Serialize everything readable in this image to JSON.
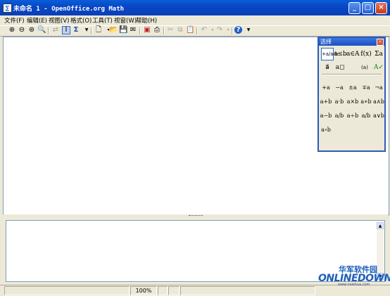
{
  "window": {
    "title": "未命名 1 - OpenOffice.org Math",
    "app_icon": "math-doc-icon",
    "buttons": [
      "_",
      "□",
      "×"
    ]
  },
  "menu": [
    "文件(F)",
    "编辑(E)",
    "视图(V)",
    "格式(O)",
    "工具(T)",
    "视窗(W)",
    "帮助(H)"
  ],
  "toolbar": [
    {
      "icon": "zoom-in-icon",
      "glyph": "⊕"
    },
    {
      "icon": "zoom-out-icon",
      "glyph": "⊖"
    },
    {
      "icon": "zoom-100-icon",
      "glyph": "⊛"
    },
    {
      "icon": "show-all-icon",
      "glyph": "🔍"
    },
    {
      "icon": "update-icon",
      "glyph": "⇄"
    },
    {
      "icon": "formula-cursor-icon",
      "glyph": "I"
    },
    {
      "icon": "sigma-icon",
      "glyph": "Σ"
    },
    {
      "icon": "new-icon",
      "glyph": "🗋"
    },
    {
      "icon": "open-icon",
      "glyph": "📂"
    },
    {
      "icon": "save-icon",
      "glyph": "💾"
    },
    {
      "icon": "mail-icon",
      "glyph": "✉"
    },
    {
      "icon": "export-pdf-icon",
      "glyph": "▣"
    },
    {
      "icon": "print-icon",
      "glyph": "⎙"
    },
    {
      "icon": "cut-icon",
      "glyph": "✂"
    },
    {
      "icon": "copy-icon",
      "glyph": "⧉"
    },
    {
      "icon": "paste-icon",
      "glyph": "📋"
    },
    {
      "icon": "undo-icon",
      "glyph": "↶"
    },
    {
      "icon": "redo-icon",
      "glyph": "↷"
    },
    {
      "icon": "help-icon",
      "glyph": "?"
    }
  ],
  "selection_panel": {
    "title": "选择",
    "categories": [
      {
        "icon": "unary-binary-operators-icon",
        "label": "+a/a·b"
      },
      {
        "icon": "relations-icon",
        "label": "a≤b"
      },
      {
        "icon": "set-operations-icon",
        "label": "a∈A"
      },
      {
        "icon": "functions-icon",
        "label": "f(x)"
      },
      {
        "icon": "operators-icon",
        "label": "Σa"
      },
      {
        "icon": "attributes-icon",
        "label": "a⃗"
      },
      {
        "icon": "others-icon",
        "label": "a◻"
      },
      {
        "icon": "brackets-icon",
        "label": "(a)"
      },
      {
        "icon": "formats-icon",
        "label": "(a b)"
      },
      {
        "icon": "format-icon",
        "label": "A✓"
      }
    ],
    "symbols": [
      "+a",
      "−a",
      "±a",
      "∓a",
      "¬a",
      "a+b",
      "a·b",
      "a×b",
      "a∗b",
      "a∧b",
      "a−b",
      "a/b",
      "a÷b",
      "a/b",
      "a∨b",
      "a∘b"
    ]
  },
  "status": {
    "zoom": "100%"
  },
  "watermark": {
    "chinese": "华军软件园",
    "brand": "ONLINEDOWN",
    "url": "www.newhua.com"
  }
}
